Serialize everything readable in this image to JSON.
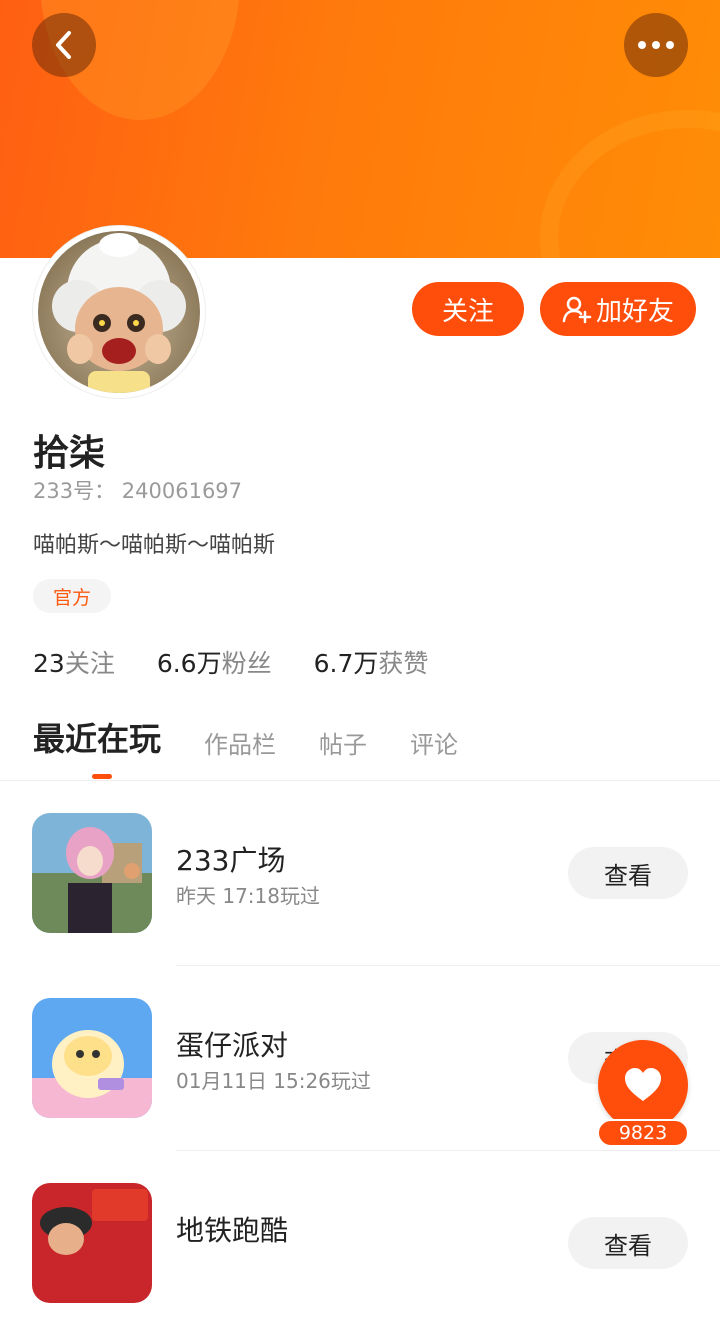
{
  "header": {
    "back_icon": "chevron-left-icon",
    "more_icon": "more-dots-icon"
  },
  "actions": {
    "follow_label": "关注",
    "add_friend_label": "加好友"
  },
  "profile": {
    "name": "拾柒",
    "uid_label": "233号：",
    "uid": "240061697",
    "bio": "喵帕斯～喵帕斯～喵帕斯",
    "badge": "官方"
  },
  "stats": [
    {
      "value": "23",
      "label": "关注"
    },
    {
      "value": "6.6万",
      "label": "粉丝"
    },
    {
      "value": "6.7万",
      "label": "获赞"
    }
  ],
  "tabs": [
    {
      "label": "最近在玩",
      "active": true
    },
    {
      "label": "作品栏",
      "active": false
    },
    {
      "label": "帖子",
      "active": false
    },
    {
      "label": "评论",
      "active": false
    }
  ],
  "games": [
    {
      "title": "233广场",
      "played": "昨天 17:18玩过",
      "button": "查看"
    },
    {
      "title": "蛋仔派对",
      "played": "01月11日 15:26玩过",
      "button": "查看"
    },
    {
      "title": "地铁跑酷",
      "played": "",
      "button": "查看"
    }
  ],
  "like": {
    "count": "9823",
    "icon": "heart-icon"
  },
  "colors": {
    "accent": "#ff4d0c",
    "banner": "#ff7a0c"
  }
}
